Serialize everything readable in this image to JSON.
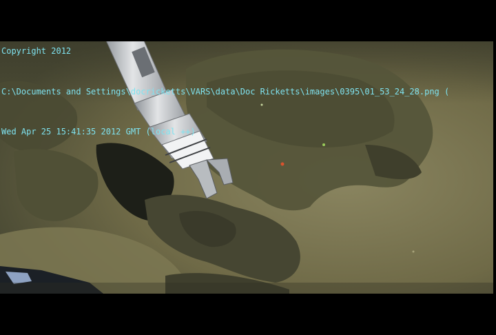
{
  "overlay": {
    "copyright": "Copyright 2012",
    "file_path": "C:\\Documents and Settings\\docricketts\\VARS\\data\\Doc Ricketts\\images\\0395\\01_53_24_28.png (",
    "timestamp": "Wed Apr 25 15:41:35 2012 GMT (local ++)",
    "text_color": "#7fe3f0"
  },
  "scene": {
    "sediment_color": "#7a7550",
    "rock_color": "#4a4a34",
    "arm_color": "#c9ccd0"
  }
}
